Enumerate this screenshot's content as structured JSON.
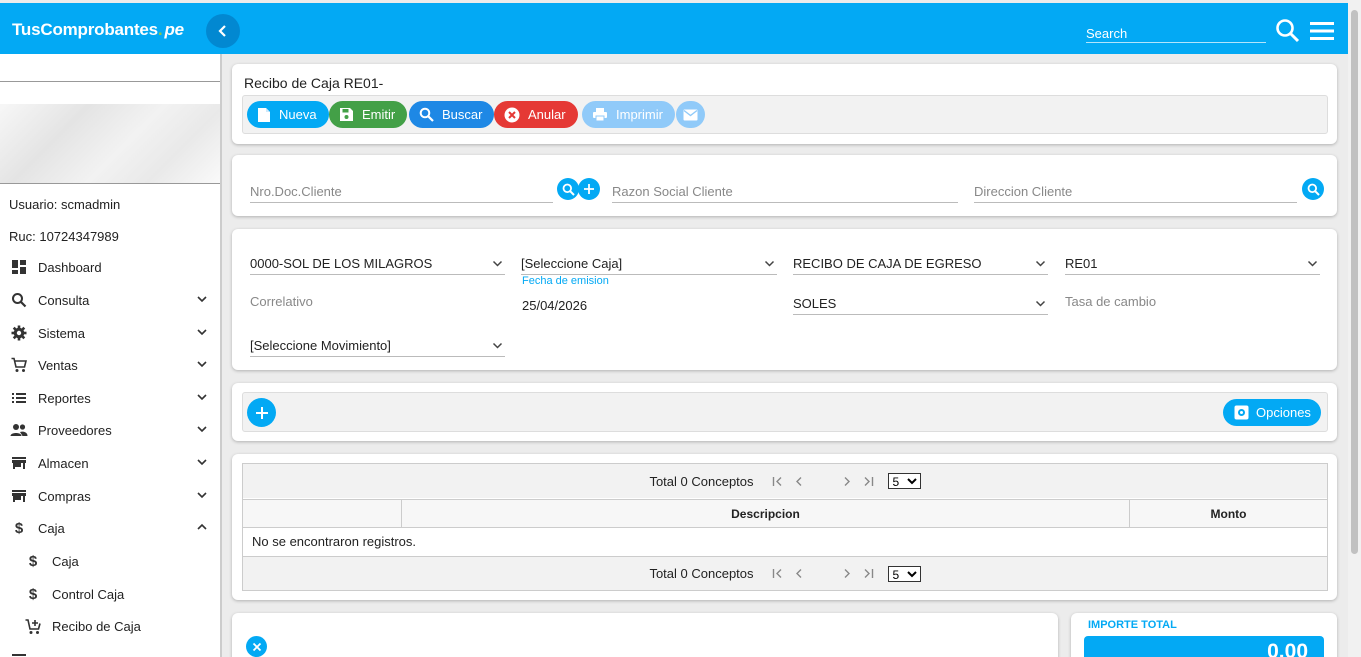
{
  "header": {
    "brand_main": "TusComprobantes",
    "brand_dot": ".",
    "brand_suffix": "pe",
    "search_placeholder": "Search"
  },
  "sidebar": {
    "user_label": "Usuario: scmadmin",
    "ruc_label": "Ruc: 10724347989",
    "items": [
      {
        "label": "Dashboard",
        "icon": "dashboard-icon",
        "expandable": false
      },
      {
        "label": "Consulta",
        "icon": "search-icon",
        "expandable": true
      },
      {
        "label": "Sistema",
        "icon": "gear-icon",
        "expandable": true
      },
      {
        "label": "Ventas",
        "icon": "cart-icon",
        "expandable": true
      },
      {
        "label": "Reportes",
        "icon": "list-icon",
        "expandable": true
      },
      {
        "label": "Proveedores",
        "icon": "people-icon",
        "expandable": true
      },
      {
        "label": "Almacen",
        "icon": "store-icon",
        "expandable": true
      },
      {
        "label": "Compras",
        "icon": "store-icon",
        "expandable": true
      },
      {
        "label": "Caja",
        "icon": "dollar-icon",
        "expandable": true,
        "expanded": true
      }
    ],
    "subitems": [
      {
        "label": "Caja",
        "icon": "dollar-icon"
      },
      {
        "label": "Control Caja",
        "icon": "dollar-icon"
      },
      {
        "label": "Recibo de Caja",
        "icon": "cart-add-icon"
      }
    ]
  },
  "page": {
    "title": "Recibo de Caja RE01-"
  },
  "toolbar": {
    "nueva": "Nueva",
    "emitir": "Emitir",
    "buscar": "Buscar",
    "anular": "Anular",
    "imprimir": "Imprimir"
  },
  "client": {
    "doc_placeholder": "Nro.Doc.Cliente",
    "razon_placeholder": "Razon Social Cliente",
    "direccion_placeholder": "Direccion Cliente"
  },
  "form": {
    "sucursal": "0000-SOL DE LOS MILAGROS",
    "caja": "[Seleccione Caja]",
    "tipo_doc": "RECIBO DE CAJA DE EGRESO",
    "serie": "RE01",
    "correlativo_placeholder": "Correlativo",
    "fecha_label": "Fecha de emision",
    "fecha_value": "25/04/2026",
    "moneda": "SOLES",
    "tasa_placeholder": "Tasa de cambio",
    "movimiento": "[Seleccione Movimiento]"
  },
  "actions": {
    "opciones": "Opciones"
  },
  "grid": {
    "total_text": "Total 0 Conceptos",
    "page_size": "5",
    "columns": [
      "",
      "Descripcion",
      "Monto"
    ],
    "empty_text": "No se encontraron registros."
  },
  "totals": {
    "label": "IMPORTE TOTAL",
    "value": "0.00"
  },
  "colors": {
    "primary": "#03a9f4",
    "success": "#43a047",
    "danger": "#e53935",
    "disabled": "#90caf9"
  }
}
